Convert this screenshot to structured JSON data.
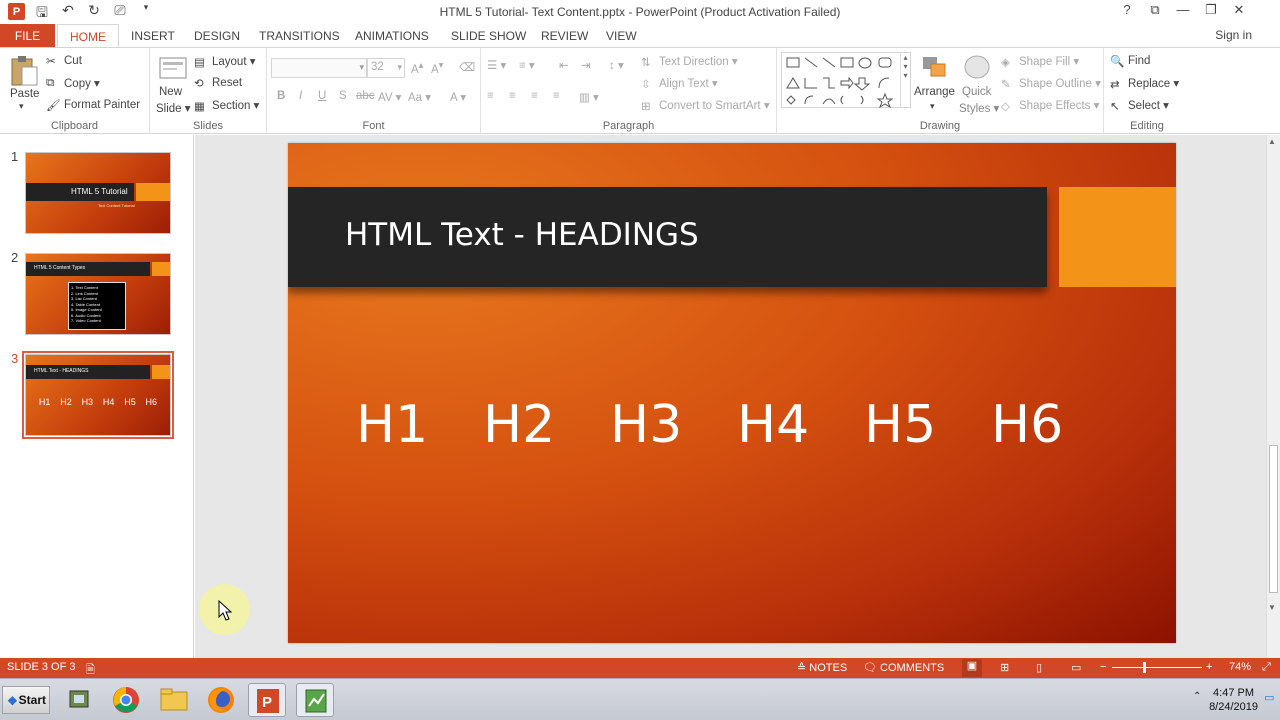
{
  "window": {
    "title": "HTML 5 Tutorial- Text Content.pptx - PowerPoint (Product Activation Failed)",
    "app_logo": "P",
    "controls": [
      "?",
      "⧉",
      "—",
      "❐",
      "✕"
    ]
  },
  "ribbon_tabs": [
    "FILE",
    "HOME",
    "INSERT",
    "DESIGN",
    "TRANSITIONS",
    "ANIMATIONS",
    "SLIDE SHOW",
    "REVIEW",
    "VIEW"
  ],
  "active_tab": "HOME",
  "sign_in": "Sign in",
  "clipboard": {
    "paste": "Paste",
    "cut": "Cut",
    "copy": "Copy",
    "format_painter": "Format Painter",
    "label": "Clipboard"
  },
  "slides_group": {
    "new_slide_1": "New",
    "new_slide_2": "Slide",
    "layout": "Layout",
    "reset": "Reset",
    "section": "Section",
    "label": "Slides"
  },
  "font_group": {
    "font_size": "32",
    "label": "Font",
    "bold": "B",
    "italic": "I",
    "underline": "U",
    "shadow": "S",
    "strike": "abc"
  },
  "paragraph_group": {
    "text_direction": "Text Direction",
    "align_text": "Align Text",
    "convert_smartart": "Convert to SmartArt",
    "label": "Paragraph"
  },
  "drawing_group": {
    "arrange": "Arrange",
    "quick_styles_1": "Quick",
    "quick_styles_2": "Styles",
    "shape_fill": "Shape Fill",
    "shape_outline": "Shape Outline",
    "shape_effects": "Shape Effects",
    "label": "Drawing"
  },
  "editing_group": {
    "find": "Find",
    "replace": "Replace",
    "select": "Select",
    "label": "Editing"
  },
  "thumbnails": [
    {
      "num": "1",
      "title": "HTML 5 Tutorial",
      "subtitle": "Text Content Tutorial"
    },
    {
      "num": "2",
      "title": "HTML 5 Content Types",
      "items": [
        "1. Text Content",
        "2. Link Content",
        "3. List Content",
        "4. Table Content",
        "5. Image Content",
        "6. Audio Content",
        "7. Video Content"
      ]
    },
    {
      "num": "3",
      "title": "HTML Text - HEADINGS",
      "heads": [
        "H1",
        "H2",
        "H3",
        "H4",
        "H5",
        "H6"
      ]
    }
  ],
  "slide": {
    "title": "HTML Text - HEADINGS",
    "headings": [
      "H1",
      "H2",
      "H3",
      "H4",
      "H5",
      "H6"
    ]
  },
  "status": {
    "slide_info": "SLIDE 3 OF 3",
    "notes": "NOTES",
    "comments": "COMMENTS",
    "zoom": "74%"
  },
  "taskbar": {
    "start": "Start",
    "time": "4:47 PM",
    "date": "8/24/2019"
  },
  "colors": {
    "accent": "#d24726",
    "slide_orange": "#f39418",
    "slide_bar": "#252525"
  }
}
